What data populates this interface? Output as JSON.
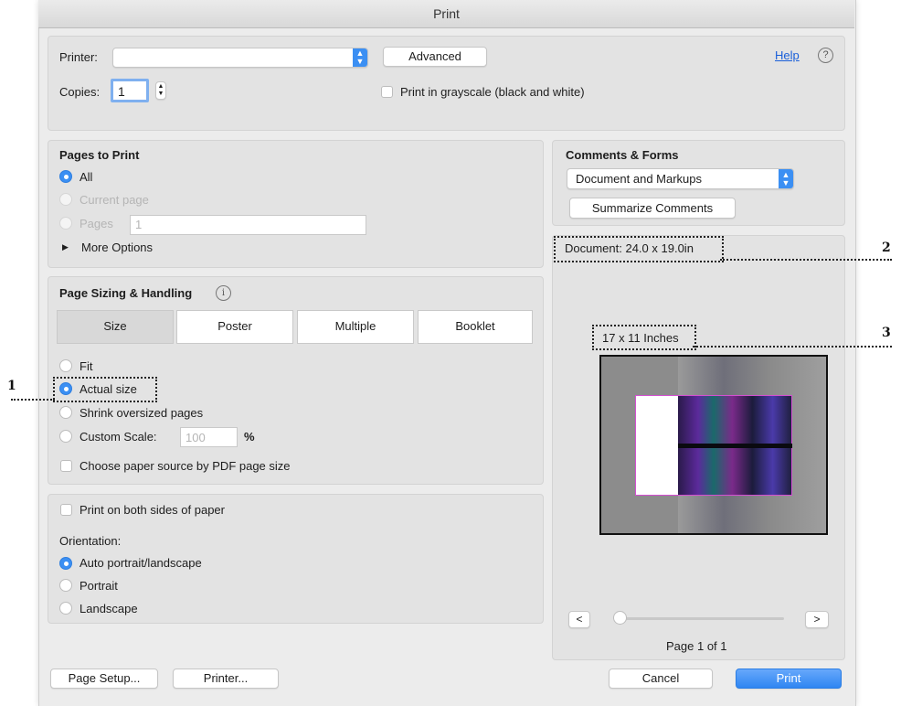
{
  "window": {
    "title": "Print"
  },
  "printer": {
    "label": "Printer:",
    "value": "",
    "advanced_label": "Advanced",
    "help_label": "Help",
    "help_icon": "?"
  },
  "copies": {
    "label": "Copies:",
    "value": "1"
  },
  "grayscale": {
    "label": "Print in grayscale (black and white)",
    "checked": false
  },
  "pages_to_print": {
    "title": "Pages to Print",
    "all_label": "All",
    "current_label": "Current page",
    "pages_label": "Pages",
    "pages_value": "1",
    "more_label": "More Options"
  },
  "page_sizing": {
    "title": "Page Sizing & Handling",
    "tabs": [
      "Size",
      "Poster",
      "Multiple",
      "Booklet"
    ],
    "active_tab": "Size",
    "fit_label": "Fit",
    "actual_label": "Actual size",
    "shrink_label": "Shrink oversized pages",
    "custom_label": "Custom Scale:",
    "custom_value": "100",
    "custom_unit": "%",
    "paper_source_label": "Choose paper source by PDF page size"
  },
  "both_sides": {
    "label": "Print on both sides of paper"
  },
  "orientation": {
    "title": "Orientation:",
    "auto_label": "Auto portrait/landscape",
    "portrait_label": "Portrait",
    "landscape_label": "Landscape"
  },
  "comments_forms": {
    "title": "Comments & Forms",
    "select_value": "Document and Markups",
    "summarize_label": "Summarize Comments"
  },
  "preview": {
    "document_label": "Document: 24.0 x 19.0in",
    "paper_label": "17 x 11 Inches",
    "prev_label": "<",
    "next_label": ">",
    "page_label": "Page 1 of 1",
    "slider_position": 0
  },
  "footer": {
    "page_setup_label": "Page Setup...",
    "printer_label": "Printer...",
    "cancel_label": "Cancel",
    "print_label": "Print"
  },
  "callouts": [
    "1",
    "2",
    "3"
  ],
  "colors": {
    "accent": "#3b8ff3",
    "panel": "#e3e3e3",
    "window": "#ececec"
  }
}
